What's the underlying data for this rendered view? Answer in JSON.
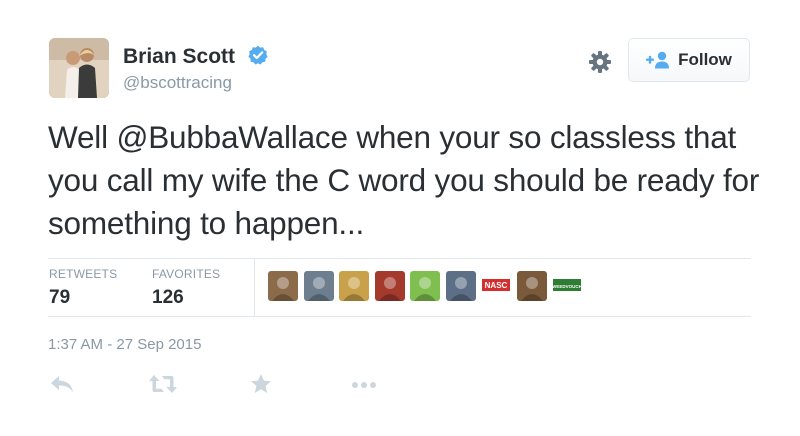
{
  "header": {
    "display_name": "Brian Scott",
    "handle": "@bscottracing",
    "follow_label": "Follow"
  },
  "tweet": {
    "text_before": "Well ",
    "mention": "@BubbaWallace",
    "text_after": " when your so classless that you call my wife the C word you should be ready for something to happen..."
  },
  "stats": {
    "retweets_label": "RETWEETS",
    "retweets_value": "79",
    "favorites_label": "FAVORITES",
    "favorites_value": "126"
  },
  "favoriter_avatars": [
    {
      "name": "favoriter-avatar-1",
      "color": "#8b6b4a"
    },
    {
      "name": "favoriter-avatar-2",
      "color": "#6d7f8f"
    },
    {
      "name": "favoriter-avatar-3",
      "color": "#c9a14a"
    },
    {
      "name": "favoriter-avatar-4",
      "color": "#a33a2c"
    },
    {
      "name": "favoriter-avatar-5",
      "color": "#7fbf4f"
    },
    {
      "name": "favoriter-avatar-6",
      "color": "#5c6f86"
    },
    {
      "name": "favoriter-avatar-7",
      "color": "#d32f2f",
      "label": "NASC"
    },
    {
      "name": "favoriter-avatar-8",
      "color": "#7a5a3a"
    },
    {
      "name": "favoriter-avatar-9",
      "color": "#2e7d32",
      "label": "WEEDVOUCH"
    }
  ],
  "timestamp": "1:37 AM - 27 Sep 2015",
  "colors": {
    "text": "#292f33",
    "muted": "#8899a6",
    "border": "#e1e8ed",
    "verified": "#55acee",
    "icon": "#ccd6dd",
    "gear": "#66757f",
    "follow_icon": "#55acee"
  },
  "icons": {
    "settings": "gear-icon",
    "verified": "verified-badge-icon",
    "follow": "follow-person-plus-icon",
    "reply": "reply-icon",
    "retweet": "retweet-icon",
    "favorite": "favorite-star-icon",
    "more": "more-dots-icon"
  }
}
